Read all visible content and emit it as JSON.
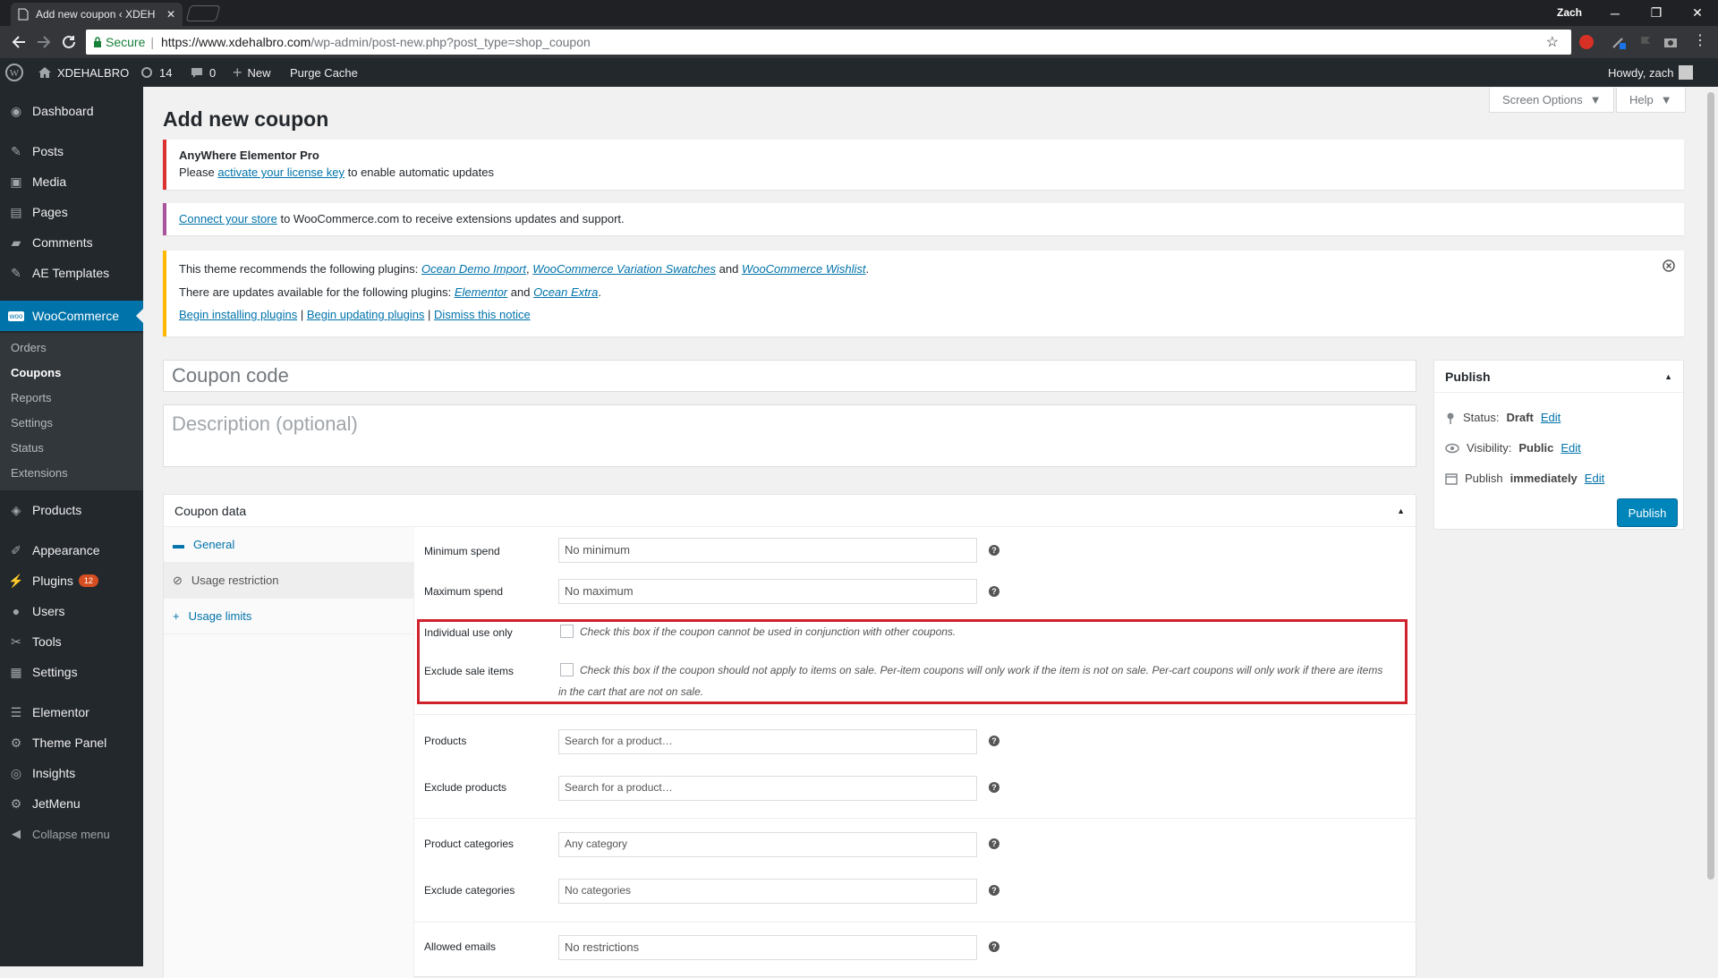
{
  "browser": {
    "tab_title": "Add new coupon ‹ XDEH",
    "profile": "Zach",
    "secure_label": "Secure",
    "url_host": "https://www.xdehalbro.com",
    "url_path": "/wp-admin/post-new.php?post_type=shop_coupon"
  },
  "adminbar": {
    "site": "XDEHALBRO",
    "updates": "14",
    "comments": "0",
    "new": "New",
    "purge": "Purge Cache",
    "howdy": "Howdy, zach"
  },
  "sidebar": {
    "items": [
      {
        "label": "Dashboard",
        "icon": "dashboard-icon"
      },
      {
        "label": "Posts",
        "icon": "pin-icon"
      },
      {
        "label": "Media",
        "icon": "media-icon"
      },
      {
        "label": "Pages",
        "icon": "page-icon"
      },
      {
        "label": "Comments",
        "icon": "comment-icon"
      },
      {
        "label": "AE Templates",
        "icon": "pin-icon"
      },
      {
        "label": "WooCommerce",
        "icon": "woo-icon"
      },
      {
        "label": "Products",
        "icon": "box-icon"
      },
      {
        "label": "Appearance",
        "icon": "brush-icon"
      },
      {
        "label": "Plugins",
        "icon": "plug-icon",
        "badge": "12"
      },
      {
        "label": "Users",
        "icon": "user-icon"
      },
      {
        "label": "Tools",
        "icon": "wrench-icon"
      },
      {
        "label": "Settings",
        "icon": "settings-icon"
      },
      {
        "label": "Elementor",
        "icon": "elementor-icon"
      },
      {
        "label": "Theme Panel",
        "icon": "gear-icon"
      },
      {
        "label": "Insights",
        "icon": "insights-icon"
      },
      {
        "label": "JetMenu",
        "icon": "gear-icon"
      },
      {
        "label": "Collapse menu",
        "icon": "collapse-icon"
      }
    ],
    "submenu": [
      "Orders",
      "Coupons",
      "Reports",
      "Settings",
      "Status",
      "Extensions"
    ]
  },
  "page": {
    "title": "Add new coupon",
    "screen_options": "Screen Options",
    "help": "Help"
  },
  "notices": {
    "n1_title": "AnyWhere Elementor Pro",
    "n1_pre": "Please",
    "n1_link": "activate your license key",
    "n1_post": "to enable automatic updates",
    "n2_link": "Connect your store",
    "n2_post": "to WooCommerce.com to receive extensions updates and support.",
    "n3_line1_pre": "This theme recommends the following plugins:",
    "n3_p1": "Ocean Demo Import",
    "n3_p2": "WooCommerce Variation Swatches",
    "n3_and": "and",
    "n3_p3": "WooCommerce Wishlist",
    "n3_line2_pre": "There are updates available for the following plugins:",
    "n3_u1": "Elementor",
    "n3_u2": "Ocean Extra",
    "n3_a1": "Begin installing plugins",
    "n3_a2": "Begin updating plugins",
    "n3_a3": "Dismiss this notice"
  },
  "form": {
    "coupon_placeholder": "Coupon code",
    "desc_placeholder": "Description (optional)"
  },
  "publish": {
    "title": "Publish",
    "status_label": "Status:",
    "status_value": "Draft",
    "visibility_label": "Visibility:",
    "visibility_value": "Public",
    "publish_label": "Publish",
    "publish_value": "immediately",
    "edit": "Edit",
    "button": "Publish"
  },
  "coupon_data": {
    "title": "Coupon data",
    "tabs": [
      "General",
      "Usage restriction",
      "Usage limits"
    ],
    "fields": {
      "min_spend_label": "Minimum spend",
      "min_spend_ph": "No minimum",
      "max_spend_label": "Maximum spend",
      "max_spend_ph": "No maximum",
      "individual_label": "Individual use only",
      "individual_desc": "Check this box if the coupon cannot be used in conjunction with other coupons.",
      "exclude_sale_label": "Exclude sale items",
      "exclude_sale_desc": "Check this box if the coupon should not apply to items on sale. Per-item coupons will only work if the item is not on sale. Per-cart coupons will only work if there are items in the cart that are not on sale.",
      "products_label": "Products",
      "products_ph": "Search for a product…",
      "exclude_products_label": "Exclude products",
      "exclude_products_ph": "Search for a product…",
      "categories_label": "Product categories",
      "categories_ph": "Any category",
      "exclude_categories_label": "Exclude categories",
      "exclude_categories_ph": "No categories",
      "emails_label": "Allowed emails",
      "emails_ph": "No restrictions"
    }
  },
  "colors": {
    "accent": "#0073aa",
    "highlight": "#d0222d",
    "notice_error": "#dc3232",
    "notice_warn": "#ffb900"
  }
}
